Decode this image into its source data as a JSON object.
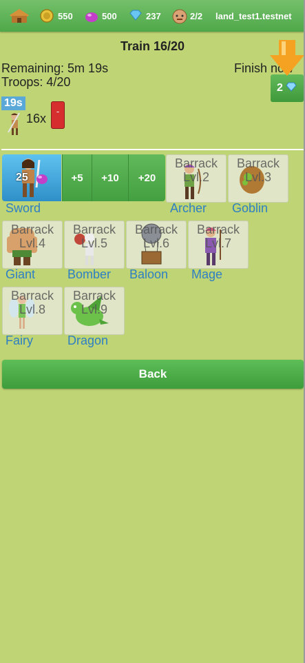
{
  "resources": {
    "gold": "550",
    "elixir": "500",
    "gems": "237",
    "builders": "2/2",
    "account": "land_test1.testnet"
  },
  "train": {
    "title": "Train 16/20",
    "remaining": "Remaining: 5m 19s",
    "troops": "Troops: 4/20",
    "finish_label": "Finish now",
    "finish_cost": "2",
    "queue_time": "19s",
    "queue_count": "16x",
    "remove_label": "-"
  },
  "selected_troop": {
    "name": "Sword",
    "cost": "25"
  },
  "add_buttons": [
    "+5",
    "+10",
    "+20"
  ],
  "troops": [
    {
      "name": "Archer",
      "lock": "Barrack",
      "level": "Lvl.2"
    },
    {
      "name": "Goblin",
      "lock": "Barrack",
      "level": "Lvl.3"
    },
    {
      "name": "Giant",
      "lock": "Barrack",
      "level": "Lvl.4"
    },
    {
      "name": "Bomber",
      "lock": "Barrack",
      "level": "Lvl.5"
    },
    {
      "name": "Baloon",
      "lock": "Barrack",
      "level": "Lvl.6"
    },
    {
      "name": "Mage",
      "lock": "Barrack",
      "level": "Lvl.7"
    },
    {
      "name": "Fairy",
      "lock": "Barrack",
      "level": "Lvl.8"
    },
    {
      "name": "Dragon",
      "lock": "Barrack",
      "level": "Lvl.9"
    }
  ],
  "back_label": "Back"
}
